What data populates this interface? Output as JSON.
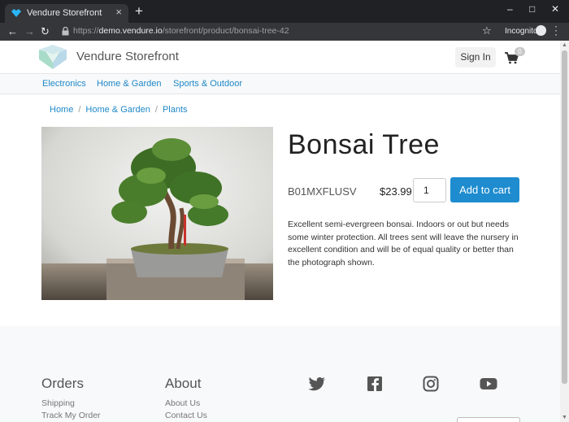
{
  "browser": {
    "tab_title": "Vendure Storefront",
    "tab_close": "×",
    "new_tab": "+",
    "url_scheme": "https://",
    "url_host": "demo.vendure.io",
    "url_path": "/storefront/product/bonsai-tree-42",
    "incognito_label": "Incognito",
    "controls": {
      "minimize": "–",
      "maximize": "□",
      "close": "✕"
    }
  },
  "header": {
    "brand": "Vendure Storefront",
    "sign_in": "Sign In",
    "cart_count": "0"
  },
  "nav": {
    "categories": [
      "Electronics",
      "Home & Garden",
      "Sports & Outdoor"
    ]
  },
  "breadcrumb": [
    "Home",
    "Home & Garden",
    "Plants"
  ],
  "product": {
    "name": "Bonsai Tree",
    "sku": "B01MXFLUSV",
    "price": "$23.99",
    "quantity": "1",
    "add_to_cart": "Add to cart",
    "description": "Excellent semi-evergreen bonsai. Indoors or out but needs some winter protection. All trees sent will leave the nursery in excellent condition and will be of equal quality or better than the photograph shown."
  },
  "footer": {
    "orders": {
      "heading": "Orders",
      "links": [
        "Shipping",
        "Track My Order"
      ]
    },
    "about": {
      "heading": "About",
      "links": [
        "About Us",
        "Contact Us"
      ]
    },
    "social_icons": [
      "twitter-icon",
      "facebook-icon",
      "instagram-icon",
      "youtube-icon"
    ]
  },
  "colors": {
    "accent": "#1e8ccf",
    "link": "#1e88c8",
    "chrome_dark": "#202124",
    "chrome_toolbar": "#35363a"
  }
}
